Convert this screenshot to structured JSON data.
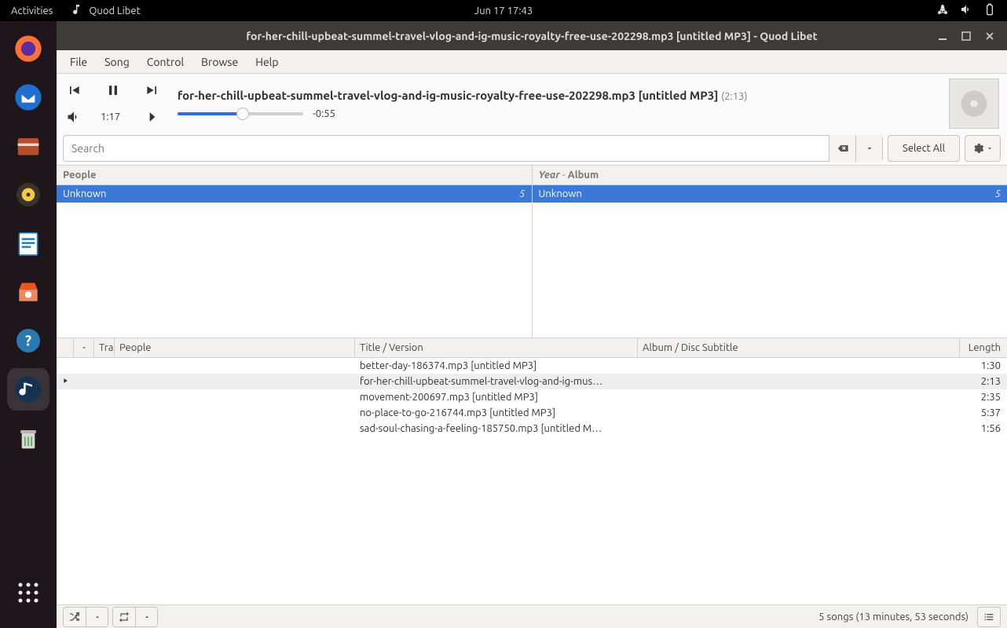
{
  "topbar": {
    "activities": "Activities",
    "app_name": "Quod Libet",
    "datetime": "Jun 17  17:43"
  },
  "window": {
    "title": "for-her-chill-upbeat-summel-travel-vlog-and-ig-music-royalty-free-use-202298.mp3 [untitled MP3] - Quod Libet"
  },
  "menubar": {
    "file": "File",
    "song": "Song",
    "control": "Control",
    "browse": "Browse",
    "help": "Help"
  },
  "player": {
    "title": "for-her-chill-upbeat-summel-travel-vlog-and-ig-music-royalty-free-use-202298.mp3 [untitled MP3]",
    "total_dur": "(2:13)",
    "elapsed": "1:17",
    "remaining": "-0:55"
  },
  "search": {
    "placeholder": "Search",
    "select_all": "Select All"
  },
  "panes": {
    "left": {
      "header": "People",
      "rows": [
        {
          "label": "Unknown",
          "count": "5"
        }
      ]
    },
    "right": {
      "header_year": "Year",
      "header_sep": " - ",
      "header_album": "Album",
      "rows": [
        {
          "label": "Unknown",
          "count": "5"
        }
      ]
    }
  },
  "columns": {
    "track": "Tra",
    "people": "People",
    "title": "Title / Version",
    "album": "Album / Disc Subtitle",
    "length": "Length"
  },
  "tracks": [
    {
      "playing": false,
      "title": "better-day-186374.mp3 [untitled MP3]",
      "len": "1:30"
    },
    {
      "playing": true,
      "title": "for-her-chill-upbeat-summel-travel-vlog-and-ig-mus…",
      "len": "2:13"
    },
    {
      "playing": false,
      "title": "movement-200697.mp3 [untitled MP3]",
      "len": "2:35"
    },
    {
      "playing": false,
      "title": "no-place-to-go-216744.mp3 [untitled MP3]",
      "len": "5:37"
    },
    {
      "playing": false,
      "title": "sad-soul-chasing-a-feeling-185750.mp3 [untitled M…",
      "len": "1:56"
    }
  ],
  "status": {
    "summary": "5 songs (13 minutes, 53 seconds)"
  }
}
